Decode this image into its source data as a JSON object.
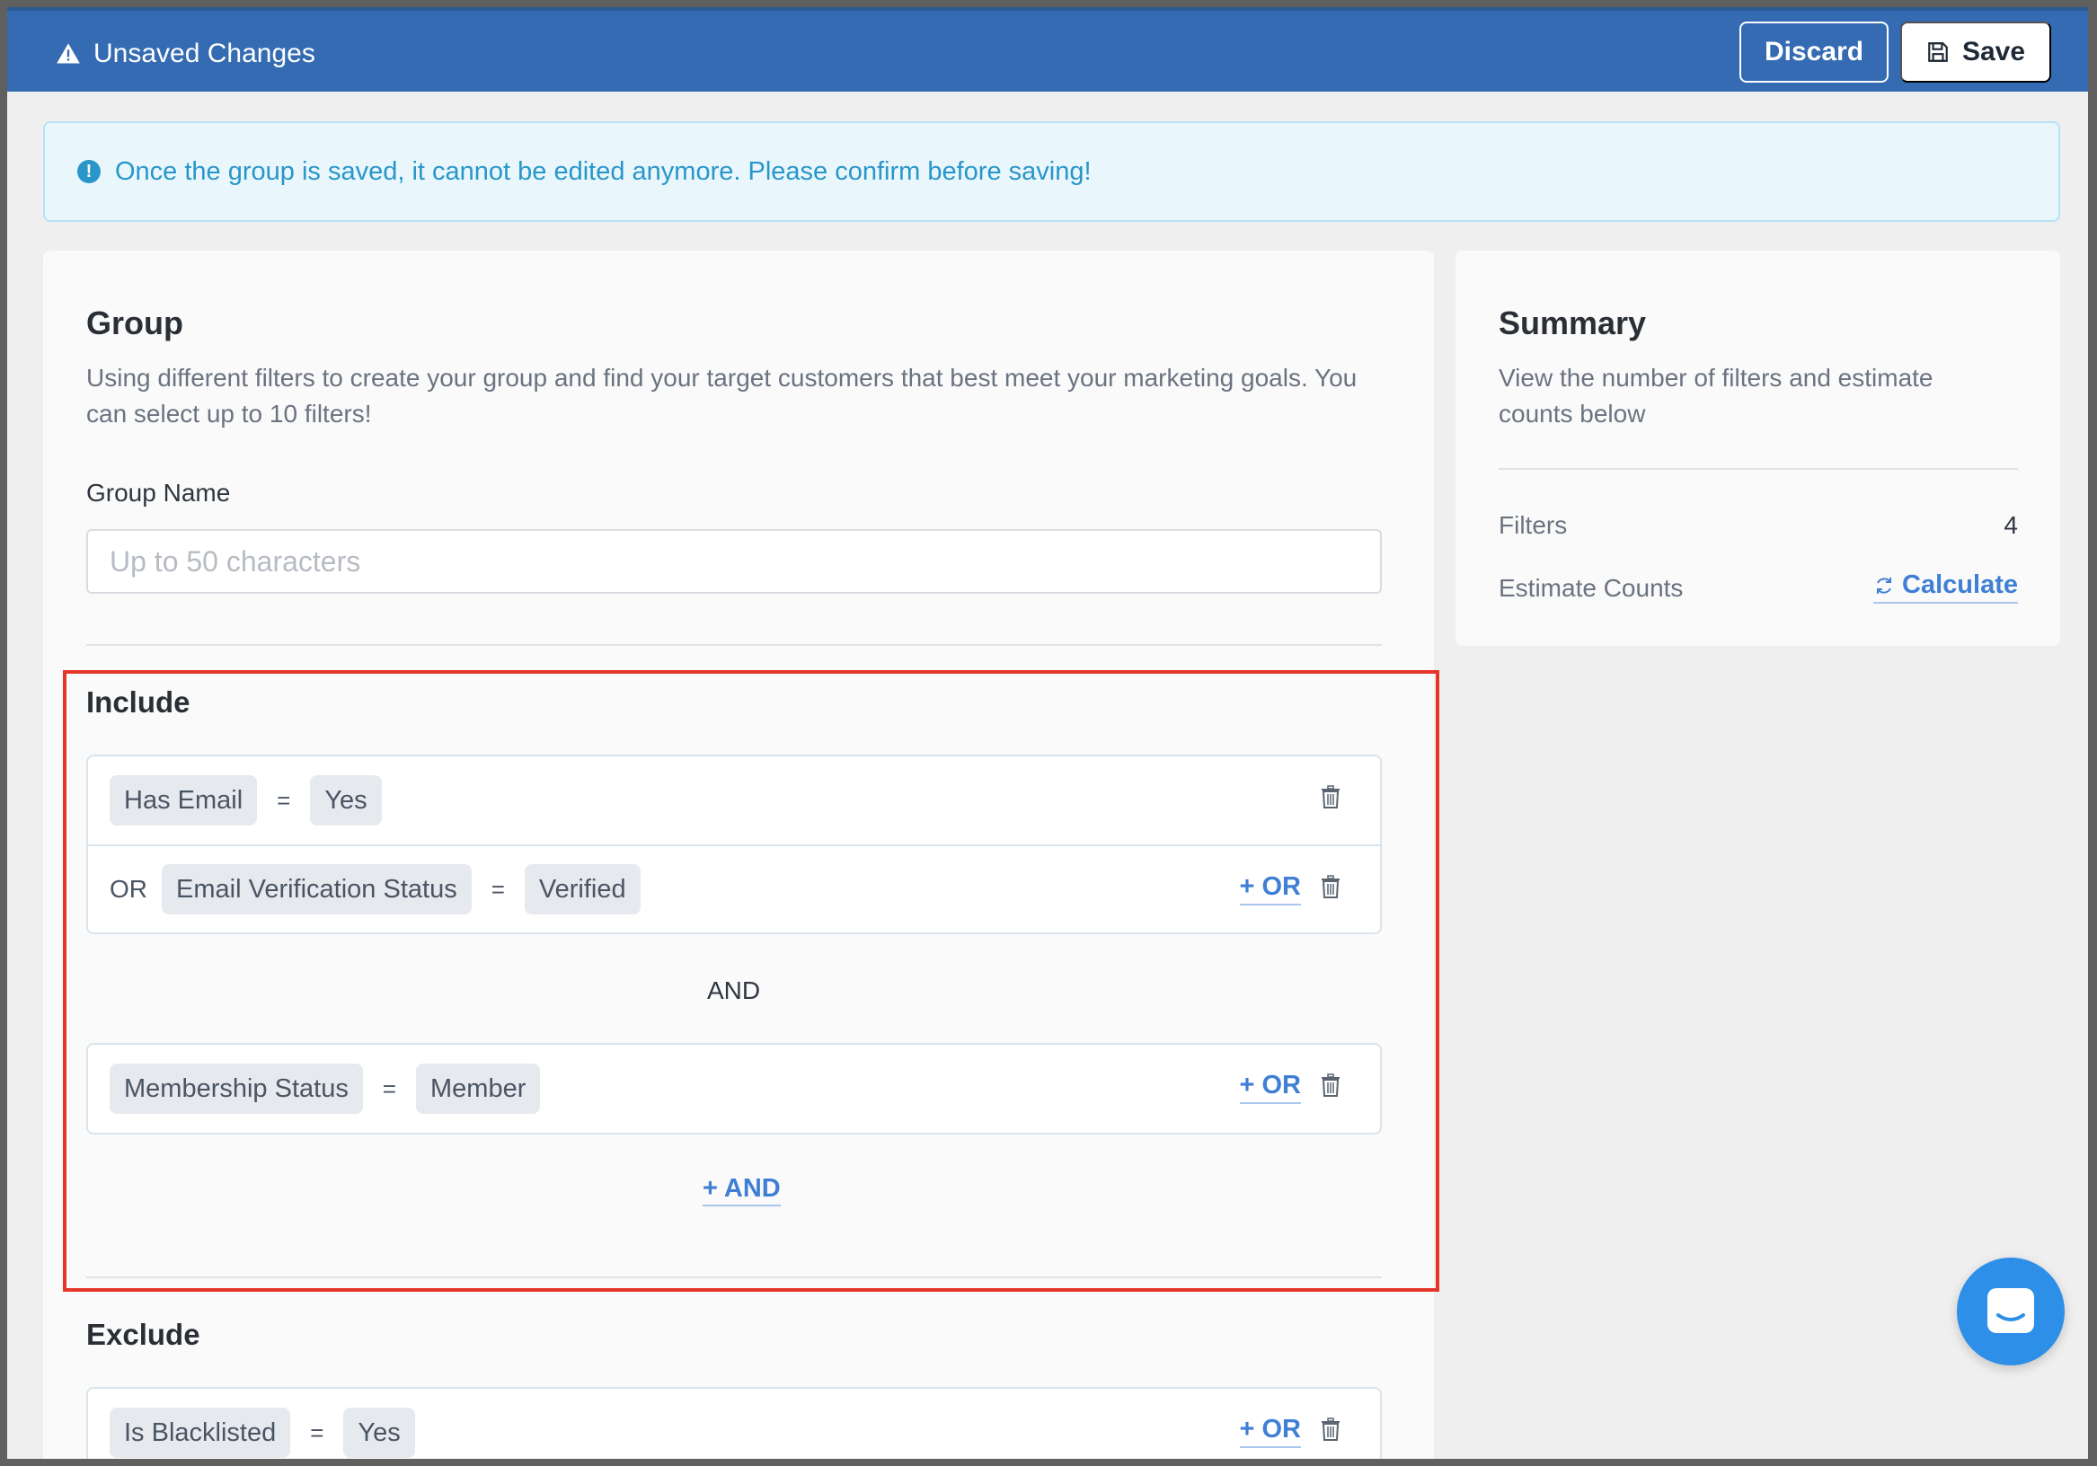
{
  "topbar": {
    "status_text": "Unsaved Changes",
    "discard_label": "Discard",
    "save_label": "Save"
  },
  "alert": {
    "text": "Once the group is saved, it cannot be edited anymore. Please confirm before saving!"
  },
  "group": {
    "title": "Group",
    "description": "Using different filters to create your group and find your target customers that best meet your marketing goals. You can select up to 10 filters!",
    "name_label": "Group Name",
    "name_value": "",
    "name_placeholder": "Up to 50 characters"
  },
  "include": {
    "title": "Include",
    "or_word": "OR",
    "and_word": "AND",
    "add_or_label": "+ OR",
    "add_and_label": "+ AND",
    "groups": [
      {
        "rows": [
          {
            "field": "Has Email",
            "operator": "=",
            "value": "Yes"
          },
          {
            "field": "Email Verification Status",
            "operator": "=",
            "value": "Verified"
          }
        ]
      },
      {
        "rows": [
          {
            "field": "Membership Status",
            "operator": "=",
            "value": "Member"
          }
        ]
      }
    ]
  },
  "exclude": {
    "title": "Exclude",
    "add_or_label": "+ OR",
    "groups": [
      {
        "rows": [
          {
            "field": "Is Blacklisted",
            "operator": "=",
            "value": "Yes"
          }
        ]
      }
    ]
  },
  "summary": {
    "title": "Summary",
    "description": "View the number of filters and estimate counts below",
    "filters_label": "Filters",
    "filters_value": "4",
    "estimate_label": "Estimate Counts",
    "calculate_label": "Calculate"
  },
  "colors": {
    "topbar": "#346bb3",
    "accent_link": "#3f7fd4",
    "alert_text": "#2996c9",
    "highlight_border": "#e6362a",
    "chat_button": "#2e8fe9"
  },
  "icons": {
    "warning": "warning-triangle-icon",
    "save": "floppy-disk-icon",
    "info": "info-circle-icon",
    "trash": "trash-icon",
    "refresh": "refresh-icon",
    "chat": "chat-icon"
  }
}
